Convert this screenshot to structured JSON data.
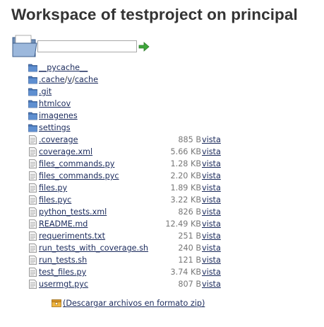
{
  "page": {
    "title": "Workspace of testproject on principal"
  },
  "path_bar": {
    "value": "",
    "placeholder": ""
  },
  "colors": {
    "link": "#1a2a5c",
    "folder": "#4a78b8",
    "go_arrow": "#3fa73b",
    "zip_icon": "#e0a12a"
  },
  "icons": {
    "folder": "folder-icon",
    "file": "file-icon",
    "go": "go-arrow-icon",
    "zip": "zip-archive-icon"
  },
  "directories": [
    {
      "name": "__pycache__"
    },
    {
      "name": ".cache",
      "parts": [
        ".cache",
        "v",
        "cache"
      ]
    },
    {
      "name": ".git"
    },
    {
      "name": "htmlcov"
    },
    {
      "name": "imagenes"
    },
    {
      "name": "settings"
    }
  ],
  "files": [
    {
      "name": ".coverage",
      "size": "885 B",
      "view": "vista"
    },
    {
      "name": "coverage.xml",
      "size": "5.66 KB",
      "view": "vista"
    },
    {
      "name": "files_commands.py",
      "size": "1.28 KB",
      "view": "vista"
    },
    {
      "name": "files_commands.pyc",
      "size": "2.20 KB",
      "view": "vista"
    },
    {
      "name": "files.py",
      "size": "1.89 KB",
      "view": "vista"
    },
    {
      "name": "files.pyc",
      "size": "3.22 KB",
      "view": "vista"
    },
    {
      "name": "python_tests.xml",
      "size": "826 B",
      "view": "vista"
    },
    {
      "name": "README.md",
      "size": "12.49 KB",
      "view": "vista"
    },
    {
      "name": "requeriments.txt",
      "size": "251 B",
      "view": "vista"
    },
    {
      "name": "run_tests_with_coverage.sh",
      "size": "240 B",
      "view": "vista"
    },
    {
      "name": "run_tests.sh",
      "size": "121 B",
      "view": "vista"
    },
    {
      "name": "test_files.py",
      "size": "3.74 KB",
      "view": "vista"
    },
    {
      "name": "usermgt.pyc",
      "size": "807 B",
      "view": "vista"
    }
  ],
  "download": {
    "label": "(Descargar archivos en formato zip)"
  }
}
